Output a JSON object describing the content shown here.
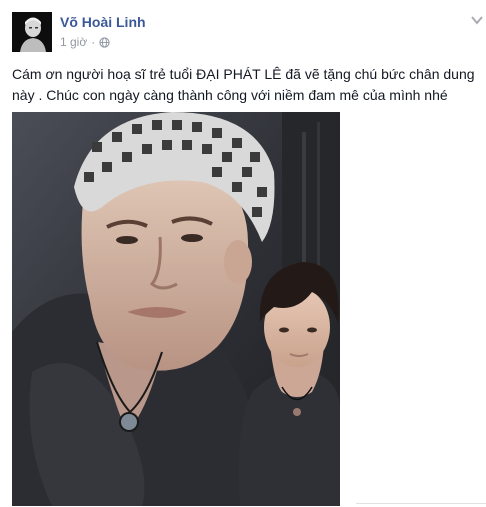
{
  "post": {
    "author_name": "Võ Hoài Linh",
    "timestamp": "1 giờ",
    "separator": "·",
    "privacy_icon": "globe-icon",
    "menu_icon": "chevron-down-icon",
    "caption": "Cám ơn người hoạ sĩ trẻ tuổi ĐẠI PHÁT LÊ đã vẽ tặng chú bức chân dung này . Chúc con ngày càng thành công với niềm đam mê của mình nhé"
  },
  "colors": {
    "author": "#3b5998",
    "meta": "#9197a3",
    "text": "#141823"
  }
}
